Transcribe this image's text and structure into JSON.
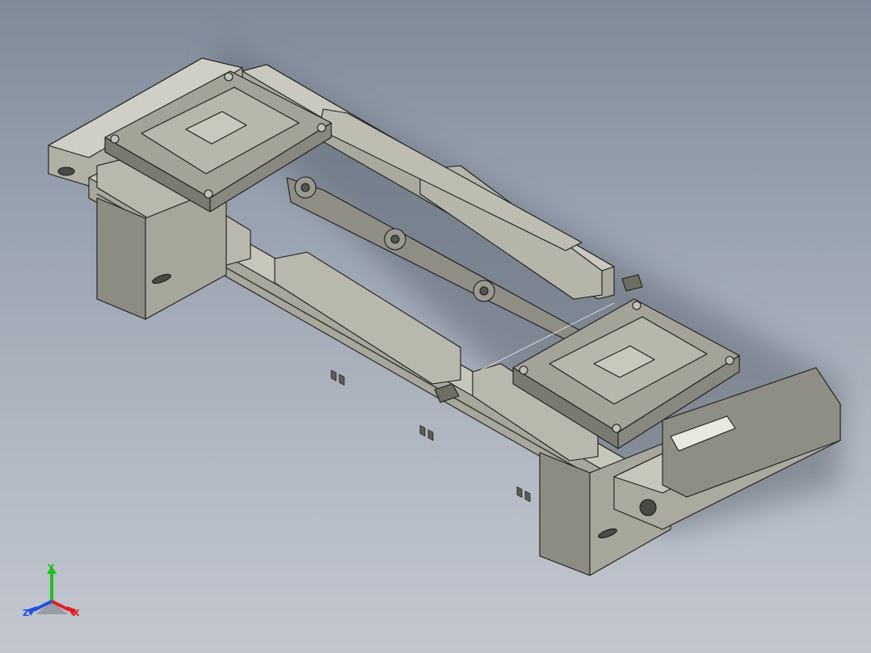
{
  "viewport": {
    "background_top": "#7f8a99",
    "background_bottom": "#c2c7cf",
    "part_fill": "#b9b9ae",
    "part_dark": "#77776d",
    "outline": "#1d1d1b"
  },
  "triad": {
    "x_label": "X",
    "y_label": "Y",
    "z_label": "Z",
    "x_color": "#e02020",
    "y_color": "#20c020",
    "z_color": "#2050e0"
  }
}
